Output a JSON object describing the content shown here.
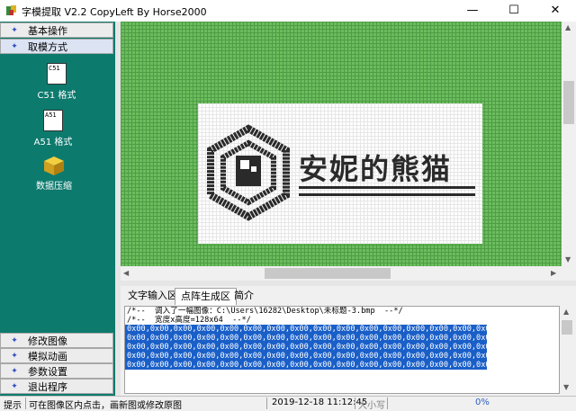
{
  "window": {
    "title": "字模提取 V2.2  CopyLeft By Horse2000",
    "minimize_glyph": "—",
    "maximize_glyph": "☐",
    "close_glyph": "✕"
  },
  "sidebar": {
    "top_buttons": [
      {
        "label": "基本操作",
        "icon": "chevron-icon"
      },
      {
        "label": "取模方式",
        "icon": "chevron-icon"
      }
    ],
    "tools": [
      {
        "label": "C51 格式",
        "icon_text": "C51"
      },
      {
        "label": "A51 格式",
        "icon_text": "A51"
      },
      {
        "label": "数据压缩",
        "icon": "cube-icon"
      }
    ],
    "bottom_buttons": [
      {
        "label": "修改图像",
        "icon": "chevron-icon"
      },
      {
        "label": "模拟动画",
        "icon": "chevron-icon"
      },
      {
        "label": "参数设置",
        "icon": "chevron-icon"
      },
      {
        "label": "退出程序",
        "icon": "chevron-icon"
      }
    ],
    "accent_color": "#0d7a6e"
  },
  "canvas": {
    "bitmap_text": "安妮的熊猫",
    "grid_color": "#6bbd5e"
  },
  "tabs": [
    {
      "label": "文字输入区",
      "active": false
    },
    {
      "label": "点阵生成区",
      "active": true
    },
    {
      "label": "简介",
      "active": false
    }
  ],
  "output": {
    "lines": [
      "/*--  调入了一幅图像：C:\\Users\\16282\\Desktop\\未标题-3.bmp  --*/",
      "/*--  宽度x高度=128x64  --*/",
      "0x00,0x00,0x00,0x00,0x00,0x00,0x00,0x00,0x00,0x00,0x00,0x00,0x00,0x00,0x00,0x00,",
      "0x00,0x00,0x00,0x00,0x00,0x00,0x00,0x00,0x00,0x00,0x00,0x00,0x00,0x00,0x00,0x00,",
      "0x00,0x00,0x00,0x00,0x00,0x00,0x00,0x00,0x00,0x00,0x00,0x00,0x00,0x00,0x00,0x00,",
      "0x00,0x00,0x00,0x00,0x00,0x00,0x00,0x00,0x00,0x00,0x00,0x00,0x00,0x00,0x00,0x00,",
      "0x00,0x00,0x00,0x00,0x00,0x00,0x00,0x00,0x00,0x00,0x00,0x00,0x00,0x00,0x00,0x00,"
    ],
    "selection_color": "#1a5fc8"
  },
  "status": {
    "label": "提示",
    "hint": "可在图像区内点击，画新图或修改原图",
    "datetime": "2019-12-18 11:12:45",
    "caps": "大小写",
    "progress": "0%"
  }
}
